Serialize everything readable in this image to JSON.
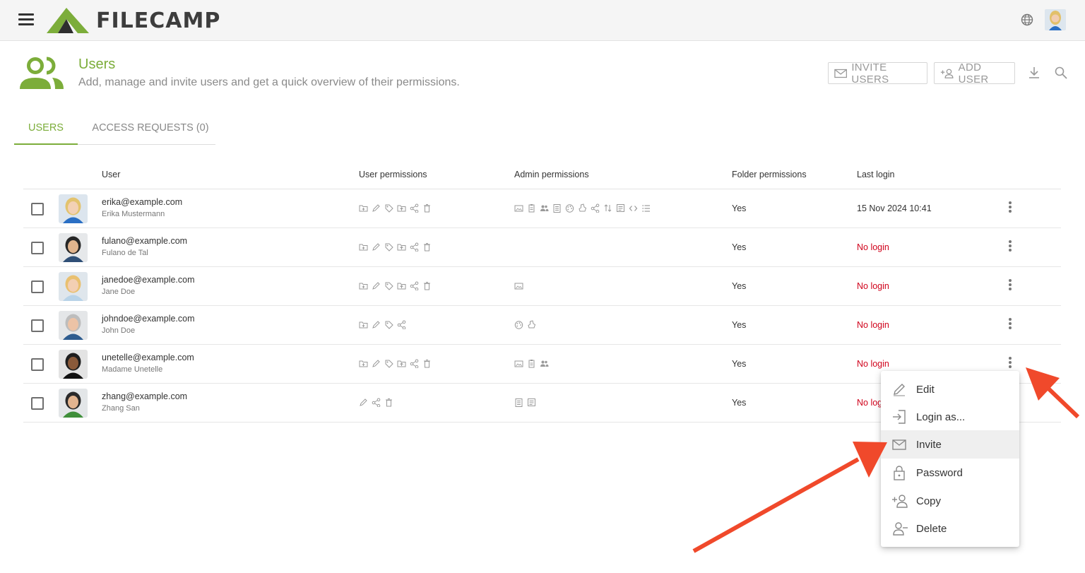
{
  "app": {
    "brand": "FILECAMP"
  },
  "header": {
    "menu_icon": "hamburger-icon",
    "language_icon": "globe-icon"
  },
  "page": {
    "title": "Users",
    "subtitle": "Add, manage and invite users and get a quick overview of their permissions.",
    "invite_label": "INVITE USERS",
    "add_label": "ADD USER"
  },
  "tabs": [
    {
      "label": "USERS",
      "active": true
    },
    {
      "label": "ACCESS REQUESTS (0)",
      "active": false
    }
  ],
  "columns": {
    "user": "User",
    "user_permissions": "User permissions",
    "admin_permissions": "Admin permissions",
    "folder_permissions": "Folder permissions",
    "last_login": "Last login"
  },
  "users": [
    {
      "email": "erika@example.com",
      "name": "Erika Mustermann",
      "folder": "Yes",
      "last_login": "15 Nov 2024 10:41",
      "logged_in": true,
      "user_perms": [
        "folder-add",
        "edit",
        "tag",
        "upload",
        "share",
        "delete"
      ],
      "admin_perms": [
        "folder-image",
        "clipboard",
        "users",
        "document",
        "palette",
        "stamp",
        "share",
        "transfer",
        "form",
        "code",
        "list"
      ]
    },
    {
      "email": "fulano@example.com",
      "name": "Fulano de Tal",
      "folder": "Yes",
      "last_login": "No login",
      "logged_in": false,
      "user_perms": [
        "folder-add",
        "edit",
        "tag",
        "upload",
        "share",
        "delete"
      ],
      "admin_perms": []
    },
    {
      "email": "janedoe@example.com",
      "name": "Jane Doe",
      "folder": "Yes",
      "last_login": "No login",
      "logged_in": false,
      "user_perms": [
        "folder-add",
        "edit",
        "tag",
        "upload",
        "share",
        "delete"
      ],
      "admin_perms": [
        "folder-image"
      ]
    },
    {
      "email": "johndoe@example.com",
      "name": "John Doe",
      "folder": "Yes",
      "last_login": "No login",
      "logged_in": false,
      "user_perms": [
        "folder-add",
        "edit",
        "tag",
        "share"
      ],
      "admin_perms": [
        "palette",
        "stamp"
      ]
    },
    {
      "email": "unetelle@example.com",
      "name": "Madame Unetelle",
      "folder": "Yes",
      "last_login": "No login",
      "logged_in": false,
      "user_perms": [
        "folder-add",
        "edit",
        "tag",
        "upload",
        "share",
        "delete"
      ],
      "admin_perms": [
        "folder-image",
        "clipboard",
        "users"
      ]
    },
    {
      "email": "zhang@example.com",
      "name": "Zhang San",
      "folder": "Yes",
      "last_login": "No login",
      "logged_in": false,
      "user_perms": [
        "edit",
        "share",
        "delete"
      ],
      "admin_perms": [
        "document",
        "form"
      ]
    }
  ],
  "context_menu": {
    "items": [
      {
        "label": "Edit",
        "icon": "pencil-icon"
      },
      {
        "label": "Login as...",
        "icon": "login-icon"
      },
      {
        "label": "Invite",
        "icon": "envelope-icon",
        "highlighted": true
      },
      {
        "label": "Password",
        "icon": "lock-icon"
      },
      {
        "label": "Copy",
        "icon": "user-add-icon"
      },
      {
        "label": "Delete",
        "icon": "user-remove-icon"
      }
    ]
  },
  "colors": {
    "brand_green": "#7cad3a",
    "no_login_red": "#d0021b",
    "annotation_arrow": "#f0492b"
  }
}
